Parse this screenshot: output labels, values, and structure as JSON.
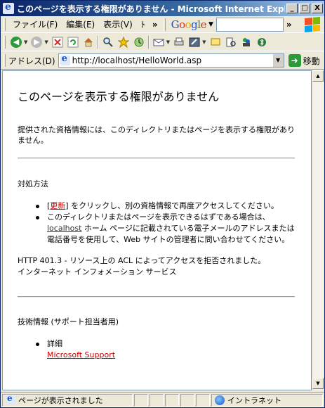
{
  "window": {
    "title": "このページを表示する権限がありません - Microsoft Internet Explorer",
    "buttons": {
      "minimize": "_",
      "maximize": "□",
      "close": "X"
    }
  },
  "menubar": {
    "items": [
      "ファイル(F)",
      "編集(E)",
      "表示(V)",
      "ﾄ"
    ],
    "chevron": "»",
    "google": {
      "letters": [
        "G",
        "o",
        "o",
        "g",
        "l",
        "e"
      ],
      "search_value": ""
    },
    "chevron2": "»"
  },
  "toolbar": {
    "icons": [
      "back-icon",
      "forward-icon",
      "stop-icon",
      "refresh-icon",
      "home-icon",
      "search-icon",
      "favorites-icon",
      "history-icon",
      "mail-icon",
      "print-icon",
      "edit-icon",
      "discuss-icon",
      "messenger-icon",
      "research-icon",
      "bluetooth-icon"
    ]
  },
  "addressbar": {
    "label": "アドレス(D)",
    "url": "http://localhost/HelloWorld.asp",
    "go_label": "移動"
  },
  "page": {
    "title": "このページを表示する権限がありません",
    "intro": "提供された資格情報には、このディレクトリまたはページを表示する権限がありません。",
    "section1_heading": "対処方法",
    "bullet1_prefix": "[",
    "bullet1_link": "更新",
    "bullet1_suffix": "] をクリックし、別の資格情報で再度アクセスしてください。",
    "bullet2_prefix": "このディレクトリまたはページを表示できるはずである場合は、",
    "bullet2_link": "localhost",
    "bullet2_suffix": " ホーム ページに記載されている電子メールのアドレスまたは電話番号を使用して、Web サイトの管理者に問い合わせてください。",
    "error_line1": "HTTP 401.3 - リソース上の ACL によってアクセスを拒否されました。",
    "error_line2": "インターネット インフォメーション サービス",
    "section2_heading": "技術情報 (サポート担当者用)",
    "detail_label": "詳細",
    "detail_link": "Microsoft Support"
  },
  "statusbar": {
    "status_text": "ページが表示されました",
    "zone_text": "イントラネット"
  }
}
